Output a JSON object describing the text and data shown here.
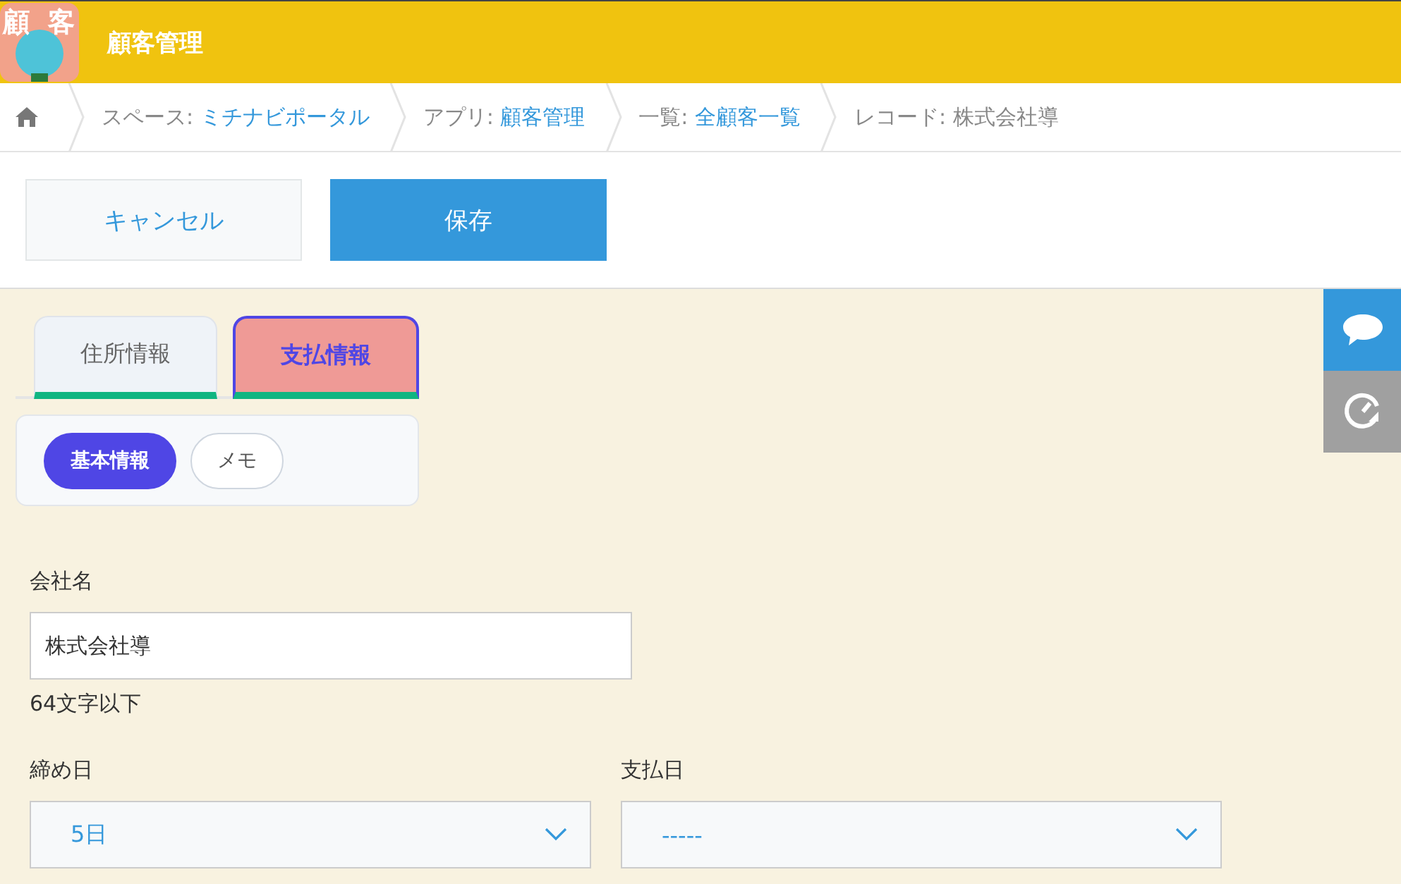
{
  "header": {
    "logo_text": [
      "顧",
      "客"
    ],
    "title": "顧客管理"
  },
  "breadcrumbs": [
    {
      "label": "スペース: ",
      "value": "ミチナビポータル",
      "link": true
    },
    {
      "label": "アプリ: ",
      "value": "顧客管理",
      "link": true
    },
    {
      "label": "一覧: ",
      "value": "全顧客一覧",
      "link": true
    },
    {
      "label": "レコード: ",
      "value": "株式会社導",
      "link": false
    }
  ],
  "actions": {
    "cancel": "キャンセル",
    "save": "保存"
  },
  "tabs": [
    {
      "label": "住所情報",
      "selected": false
    },
    {
      "label": "支払情報",
      "selected": true
    }
  ],
  "subtabs": [
    {
      "label": "基本情報",
      "selected": true
    },
    {
      "label": "メモ",
      "selected": false
    }
  ],
  "fields": [
    {
      "kind": "text",
      "label": "会社名",
      "value": "株式会社導",
      "hint": "64文字以下"
    }
  ],
  "selects": [
    {
      "label": "締め日",
      "value": "5日"
    },
    {
      "label": "支払日",
      "value": "-----"
    }
  ]
}
